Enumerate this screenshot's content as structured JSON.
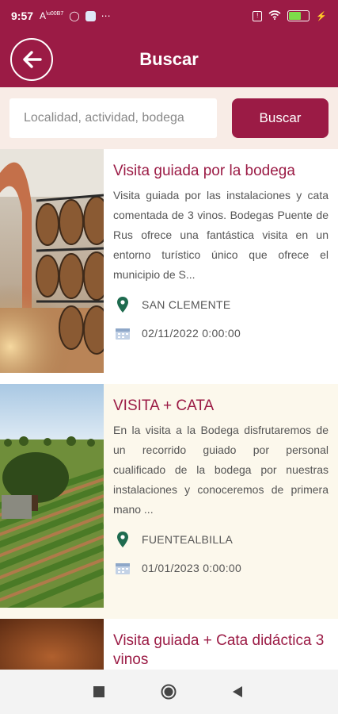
{
  "status_bar": {
    "time": "9:57",
    "icons": [
      "font-size-icon",
      "sync-icon",
      "app-icon",
      "more-dots-icon"
    ],
    "right_icons": [
      "sim-error-icon",
      "wifi-icon",
      "battery-icon",
      "charging-icon"
    ]
  },
  "header": {
    "title": "Buscar"
  },
  "search": {
    "placeholder": "Localidad, actividad, bodega",
    "button_label": "Buscar"
  },
  "results": [
    {
      "title": "Visita guiada por la bodega",
      "description": "Visita guiada por las instalaciones y cata comentada de 3 vinos. Bodegas Puente de Rus ofrece una fantástica visita en un entorno turístico único que ofrece el municipio de S...",
      "location": "SAN CLEMENTE",
      "date": "02/11/2022 0:00:00",
      "image": "wine-cellar-barrels",
      "bg": "#ffffff"
    },
    {
      "title": "VISITA + CATA",
      "description": "En la visita a la Bodega disfrutaremos de un recorrido guiado por personal cualificado de la bodega por nuestras instalaciones y conoceremos de primera mano ...",
      "location": "FUENTEALBILLA",
      "date": "01/01/2023 0:00:00",
      "image": "vineyard-rows",
      "bg": "#fcf8ec"
    },
    {
      "title": "Visita guiada + Cata didáctica 3 vinos",
      "image": "wine-cellar-warm",
      "bg": "#ffffff"
    }
  ],
  "colors": {
    "brand": "#9b1b45",
    "location_pin": "#1e6b4f",
    "text": "#555555"
  },
  "nav_bar": [
    "recent-apps-icon",
    "home-icon",
    "back-triangle-icon"
  ]
}
